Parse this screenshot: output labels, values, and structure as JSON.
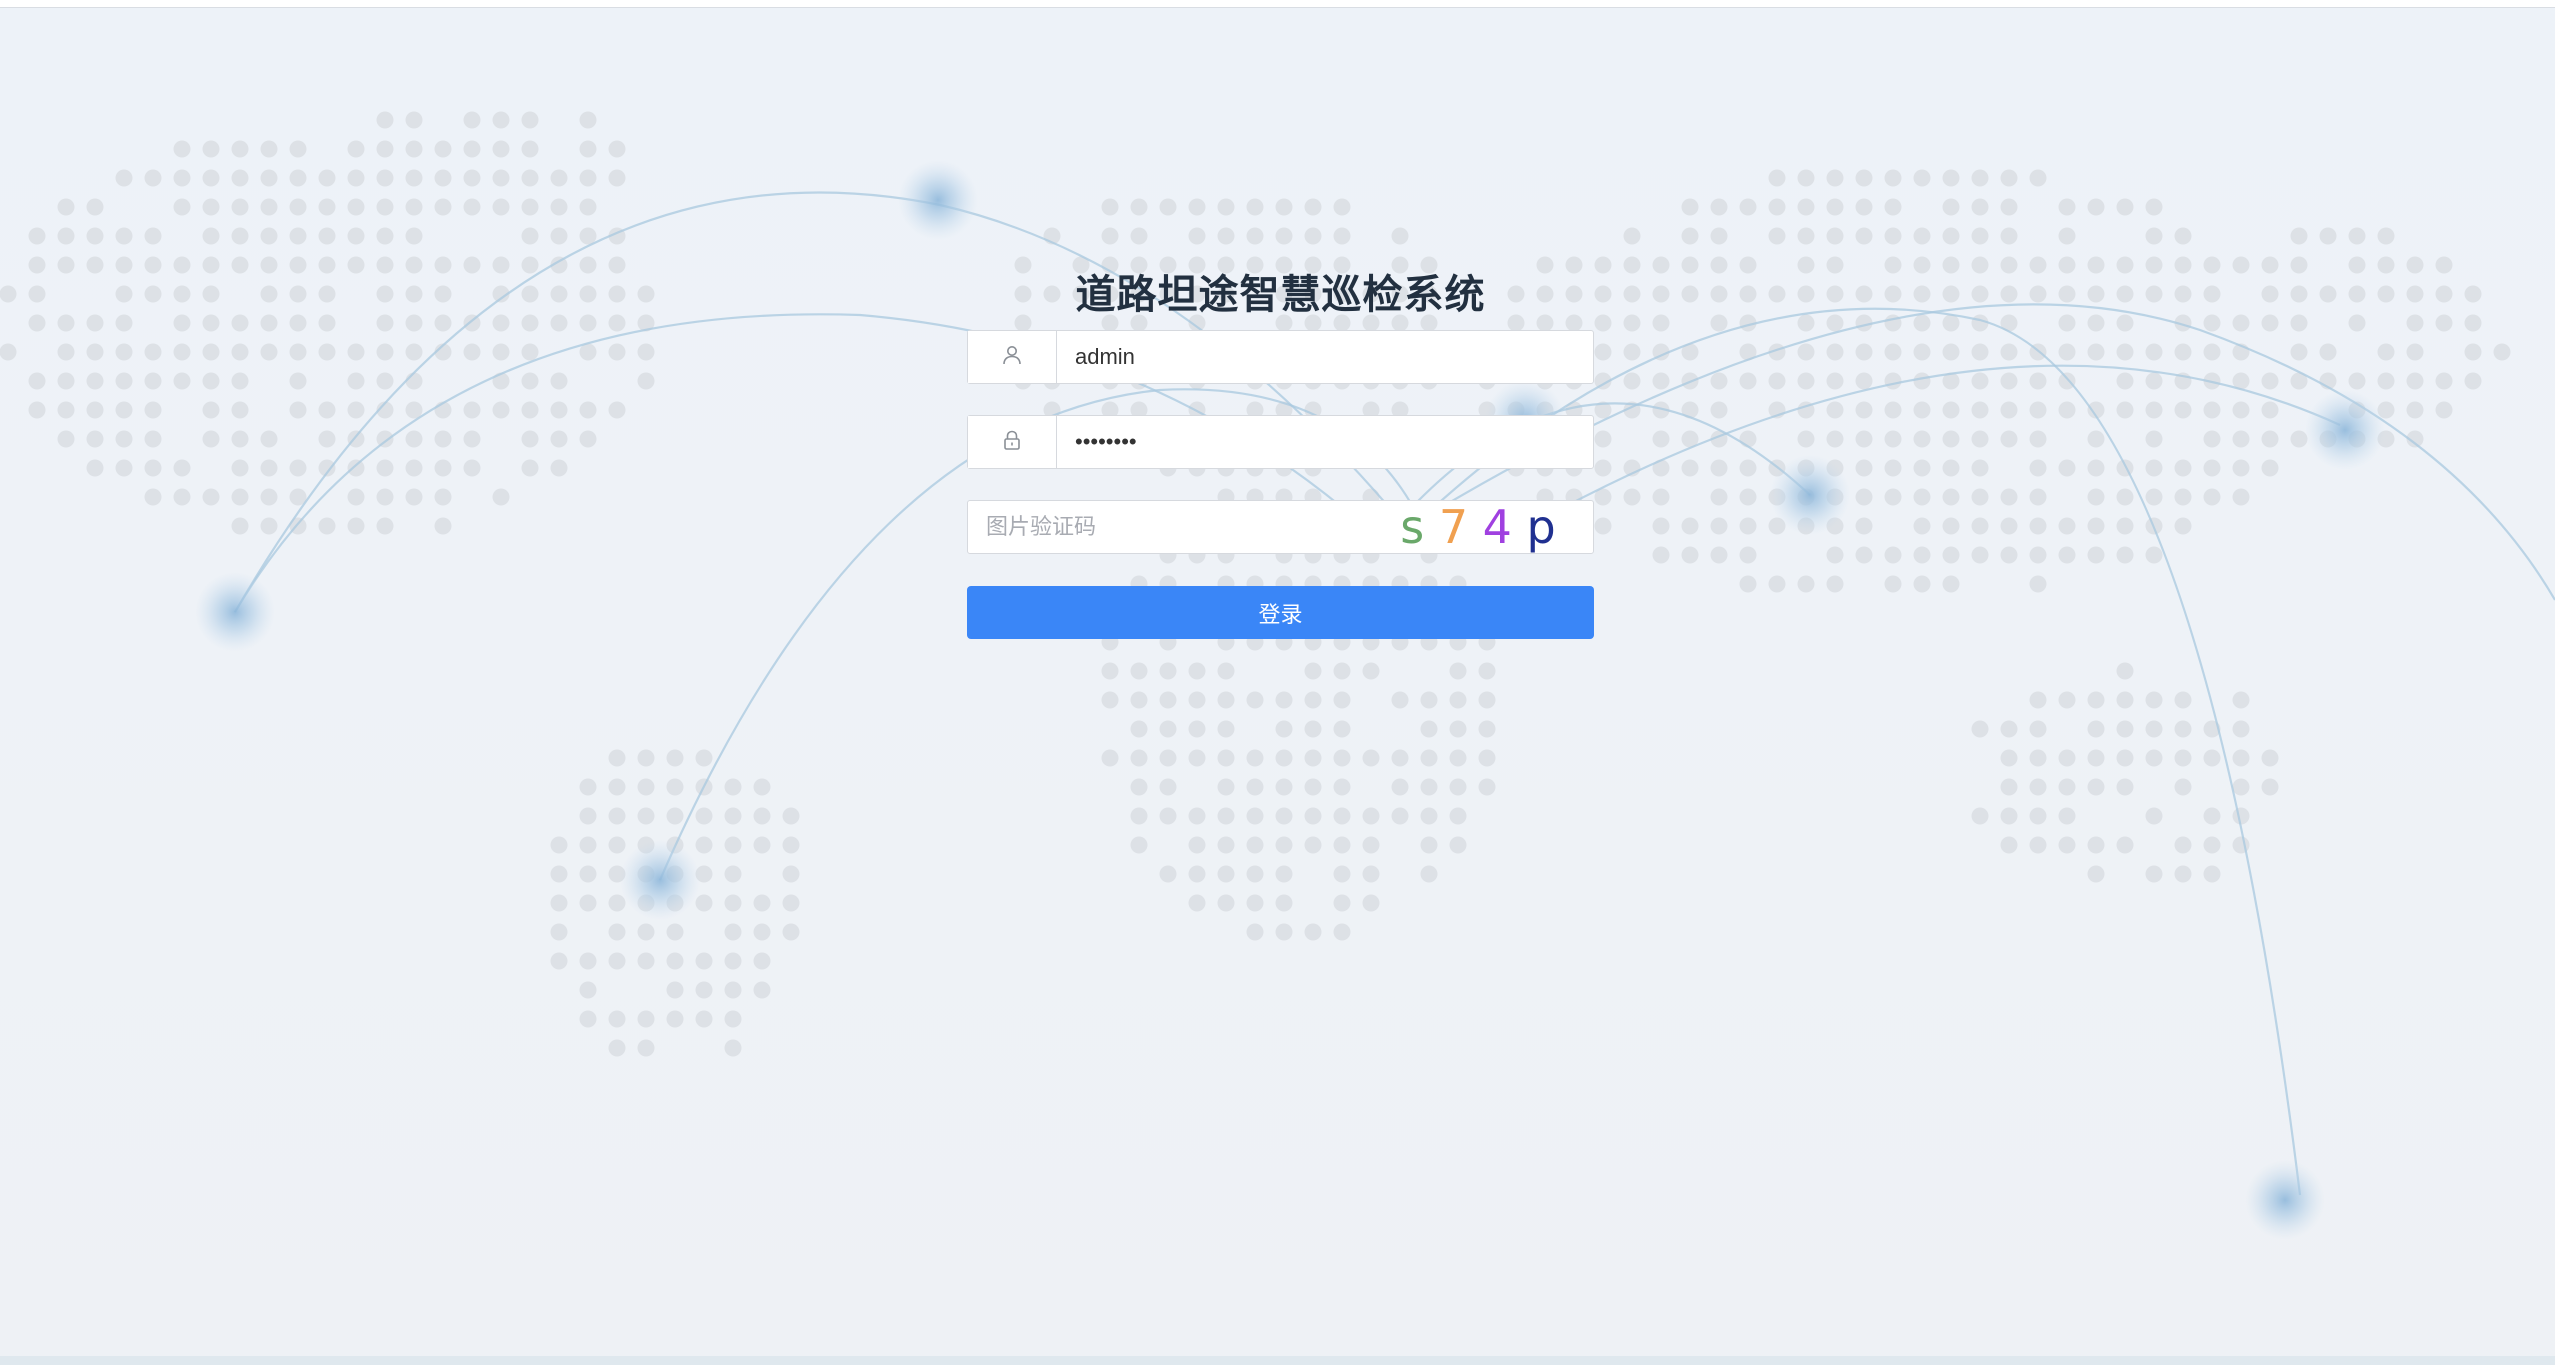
{
  "app": {
    "title": "道路坦途智慧巡检系统"
  },
  "login": {
    "username_value": "admin",
    "password_value": "••••••••",
    "captcha_placeholder": "图片验证码",
    "captcha_chars": [
      {
        "char": "s",
        "color": "#6aa86a"
      },
      {
        "char": "7",
        "color": "#f0a050"
      },
      {
        "char": "4",
        "color": "#a040e0"
      },
      {
        "char": "p",
        "color": "#203090"
      }
    ],
    "submit_label": "登录"
  },
  "icons": {
    "username": "user-icon",
    "password": "lock-icon"
  },
  "colors": {
    "primary_button": "#3a86f7",
    "title": "#223040",
    "background": "#edf2f8",
    "map_dots": "#dde1e6",
    "arcs": "#9fc3dc"
  }
}
